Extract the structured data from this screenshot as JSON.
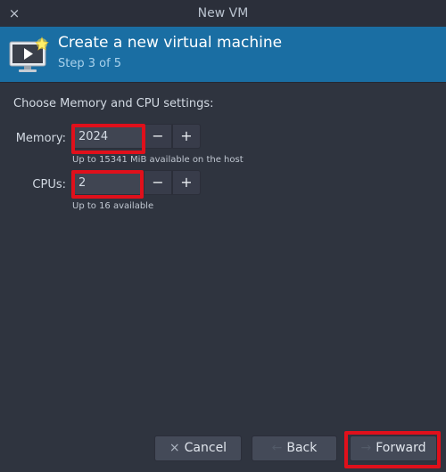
{
  "window": {
    "title": "New VM",
    "close_icon": "×"
  },
  "banner": {
    "title": "Create a new virtual machine",
    "step": "Step 3 of 5",
    "icon": "virtual-machine-icon",
    "color": "#1a6ea3"
  },
  "settings": {
    "heading": "Choose Memory and CPU settings:",
    "memory": {
      "label": "Memory:",
      "value": "2024",
      "hint": "Up to 15341 MiB available on the host",
      "decrement": "−",
      "increment": "+"
    },
    "cpus": {
      "label": "CPUs:",
      "value": "2",
      "hint": "Up to 16 available",
      "decrement": "−",
      "increment": "+"
    }
  },
  "buttons": {
    "cancel": {
      "icon": "×",
      "label": "Cancel"
    },
    "back": {
      "icon": "←",
      "label": "Back"
    },
    "forward": {
      "icon": "→",
      "label": "Forward"
    }
  },
  "colors": {
    "background": "#2f343f",
    "accent": "#1a6ea3",
    "highlight": "#e0101b"
  }
}
